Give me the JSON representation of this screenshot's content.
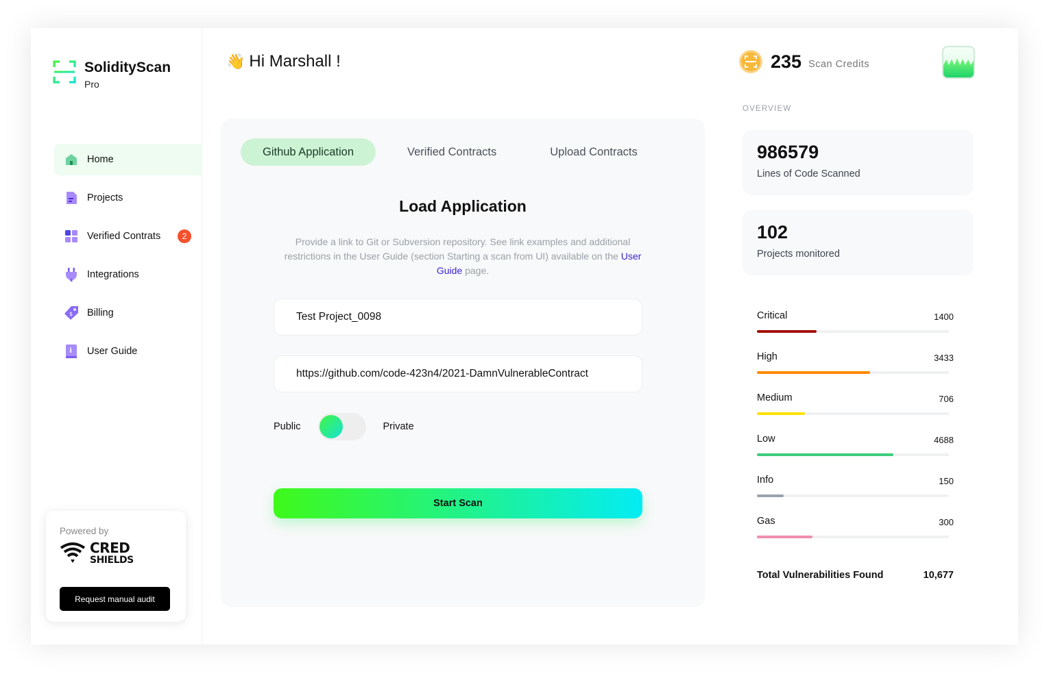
{
  "brand": {
    "name": "SolidityScan",
    "tier": "Pro",
    "accent": "#3ff91a"
  },
  "sidebar": {
    "items": [
      {
        "label": "Home",
        "icon": "home-icon",
        "active": true
      },
      {
        "label": "Projects",
        "icon": "document-icon"
      },
      {
        "label": "Verified Contrats",
        "icon": "grid-icon",
        "badge": "2"
      },
      {
        "label": "Integrations",
        "icon": "plug-icon"
      },
      {
        "label": "Billing",
        "icon": "tag-icon"
      },
      {
        "label": "User Guide",
        "icon": "info-book-icon"
      }
    ],
    "powered": {
      "label": "Powered by",
      "logo_line1": "CRED",
      "logo_line2": "SHIELDS",
      "button": "Request manual audit"
    }
  },
  "header": {
    "greeting_emoji": "👋",
    "greeting": "Hi Marshall !",
    "credits_value": "235",
    "credits_label": "Scan Credits"
  },
  "main": {
    "tabs": [
      "Github Application",
      "Verified Contracts",
      "Upload Contracts"
    ],
    "active_tab": 0,
    "title": "Load Application",
    "description_before": "Provide a link to Git or Subversion repository. See link examples and additional restrictions in the User Guide (section Starting a scan from UI) available on the",
    "description_link": "User Guide",
    "description_after": "page.",
    "project_name": "Test Project_0098",
    "repo_url": "https://github.com/code-423n4/2021-DamnVulnerableContract",
    "toggle_left": "Public",
    "toggle_right": "Private",
    "toggle_state": "Public",
    "scan_button": "Start Scan"
  },
  "overview": {
    "label": "OVERVIEW",
    "lines_scanned": "986579",
    "lines_scanned_label": "Lines of Code Scanned",
    "projects_monitored": "102",
    "projects_monitored_label": "Projects monitored",
    "vulnerabilities": [
      {
        "name": "Critical",
        "count": "1400",
        "fill": 0.31,
        "color": "#a3120b"
      },
      {
        "name": "High",
        "count": "3433",
        "fill": 0.59,
        "color": "#ff8a00"
      },
      {
        "name": "Medium",
        "count": "706",
        "fill": 0.25,
        "color": "#ffe100"
      },
      {
        "name": "Low",
        "count": "4688",
        "fill": 0.71,
        "color": "#3ecc7c"
      },
      {
        "name": "Info",
        "count": "150",
        "fill": 0.14,
        "color": "#9aa3b0"
      },
      {
        "name": "Gas",
        "count": "300",
        "fill": 0.29,
        "color": "#f08eae"
      }
    ],
    "total_label": "Total Vulnerabilities Found",
    "total_value": "10,677"
  }
}
